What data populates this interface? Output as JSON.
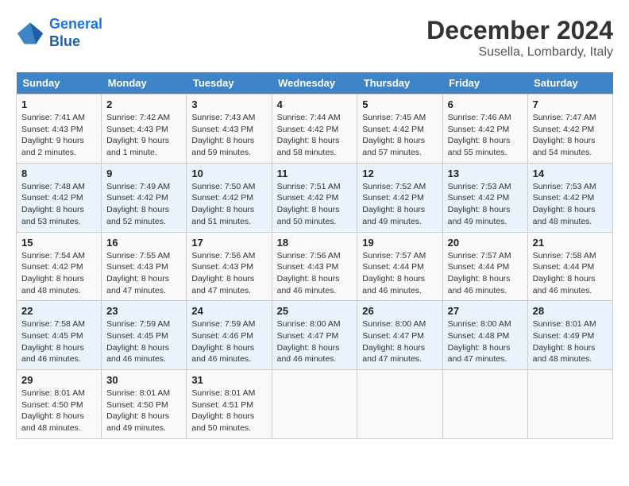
{
  "header": {
    "logo_line1": "General",
    "logo_line2": "Blue",
    "title": "December 2024",
    "subtitle": "Susella, Lombardy, Italy"
  },
  "weekdays": [
    "Sunday",
    "Monday",
    "Tuesday",
    "Wednesday",
    "Thursday",
    "Friday",
    "Saturday"
  ],
  "weeks": [
    [
      {
        "day": "1",
        "sunrise": "7:41 AM",
        "sunset": "4:43 PM",
        "daylight": "9 hours and 2 minutes."
      },
      {
        "day": "2",
        "sunrise": "7:42 AM",
        "sunset": "4:43 PM",
        "daylight": "9 hours and 1 minute."
      },
      {
        "day": "3",
        "sunrise": "7:43 AM",
        "sunset": "4:43 PM",
        "daylight": "8 hours and 59 minutes."
      },
      {
        "day": "4",
        "sunrise": "7:44 AM",
        "sunset": "4:42 PM",
        "daylight": "8 hours and 58 minutes."
      },
      {
        "day": "5",
        "sunrise": "7:45 AM",
        "sunset": "4:42 PM",
        "daylight": "8 hours and 57 minutes."
      },
      {
        "day": "6",
        "sunrise": "7:46 AM",
        "sunset": "4:42 PM",
        "daylight": "8 hours and 55 minutes."
      },
      {
        "day": "7",
        "sunrise": "7:47 AM",
        "sunset": "4:42 PM",
        "daylight": "8 hours and 54 minutes."
      }
    ],
    [
      {
        "day": "8",
        "sunrise": "7:48 AM",
        "sunset": "4:42 PM",
        "daylight": "8 hours and 53 minutes."
      },
      {
        "day": "9",
        "sunrise": "7:49 AM",
        "sunset": "4:42 PM",
        "daylight": "8 hours and 52 minutes."
      },
      {
        "day": "10",
        "sunrise": "7:50 AM",
        "sunset": "4:42 PM",
        "daylight": "8 hours and 51 minutes."
      },
      {
        "day": "11",
        "sunrise": "7:51 AM",
        "sunset": "4:42 PM",
        "daylight": "8 hours and 50 minutes."
      },
      {
        "day": "12",
        "sunrise": "7:52 AM",
        "sunset": "4:42 PM",
        "daylight": "8 hours and 49 minutes."
      },
      {
        "day": "13",
        "sunrise": "7:53 AM",
        "sunset": "4:42 PM",
        "daylight": "8 hours and 49 minutes."
      },
      {
        "day": "14",
        "sunrise": "7:53 AM",
        "sunset": "4:42 PM",
        "daylight": "8 hours and 48 minutes."
      }
    ],
    [
      {
        "day": "15",
        "sunrise": "7:54 AM",
        "sunset": "4:42 PM",
        "daylight": "8 hours and 48 minutes."
      },
      {
        "day": "16",
        "sunrise": "7:55 AM",
        "sunset": "4:43 PM",
        "daylight": "8 hours and 47 minutes."
      },
      {
        "day": "17",
        "sunrise": "7:56 AM",
        "sunset": "4:43 PM",
        "daylight": "8 hours and 47 minutes."
      },
      {
        "day": "18",
        "sunrise": "7:56 AM",
        "sunset": "4:43 PM",
        "daylight": "8 hours and 46 minutes."
      },
      {
        "day": "19",
        "sunrise": "7:57 AM",
        "sunset": "4:44 PM",
        "daylight": "8 hours and 46 minutes."
      },
      {
        "day": "20",
        "sunrise": "7:57 AM",
        "sunset": "4:44 PM",
        "daylight": "8 hours and 46 minutes."
      },
      {
        "day": "21",
        "sunrise": "7:58 AM",
        "sunset": "4:44 PM",
        "daylight": "8 hours and 46 minutes."
      }
    ],
    [
      {
        "day": "22",
        "sunrise": "7:58 AM",
        "sunset": "4:45 PM",
        "daylight": "8 hours and 46 minutes."
      },
      {
        "day": "23",
        "sunrise": "7:59 AM",
        "sunset": "4:45 PM",
        "daylight": "8 hours and 46 minutes."
      },
      {
        "day": "24",
        "sunrise": "7:59 AM",
        "sunset": "4:46 PM",
        "daylight": "8 hours and 46 minutes."
      },
      {
        "day": "25",
        "sunrise": "8:00 AM",
        "sunset": "4:47 PM",
        "daylight": "8 hours and 46 minutes."
      },
      {
        "day": "26",
        "sunrise": "8:00 AM",
        "sunset": "4:47 PM",
        "daylight": "8 hours and 47 minutes."
      },
      {
        "day": "27",
        "sunrise": "8:00 AM",
        "sunset": "4:48 PM",
        "daylight": "8 hours and 47 minutes."
      },
      {
        "day": "28",
        "sunrise": "8:01 AM",
        "sunset": "4:49 PM",
        "daylight": "8 hours and 48 minutes."
      }
    ],
    [
      {
        "day": "29",
        "sunrise": "8:01 AM",
        "sunset": "4:50 PM",
        "daylight": "8 hours and 48 minutes."
      },
      {
        "day": "30",
        "sunrise": "8:01 AM",
        "sunset": "4:50 PM",
        "daylight": "8 hours and 49 minutes."
      },
      {
        "day": "31",
        "sunrise": "8:01 AM",
        "sunset": "4:51 PM",
        "daylight": "8 hours and 50 minutes."
      },
      null,
      null,
      null,
      null
    ]
  ]
}
